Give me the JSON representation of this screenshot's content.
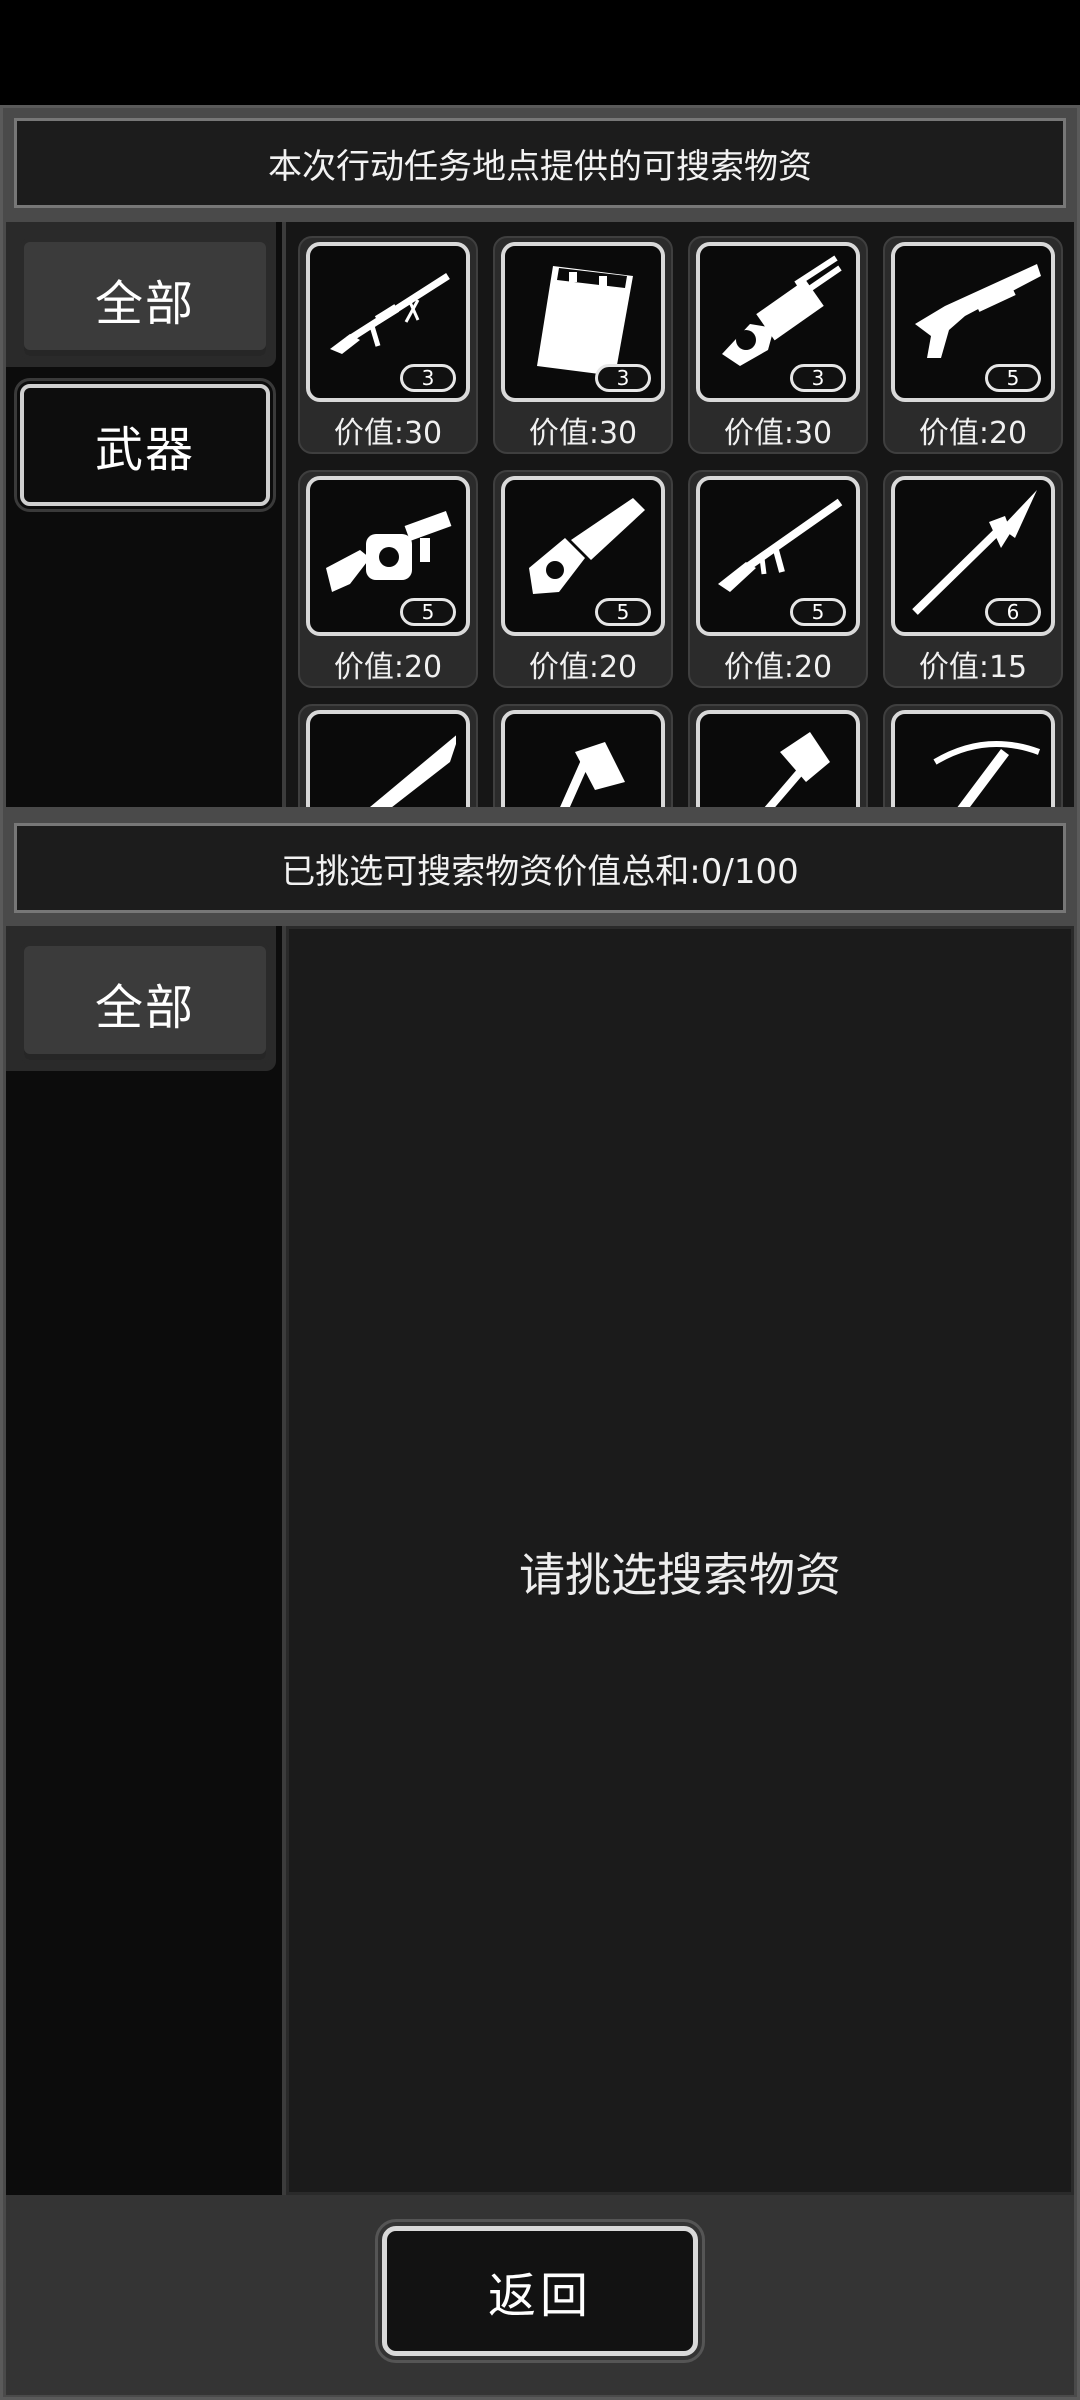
{
  "top_banner": {
    "text": "本次行动任务地点提供的可搜索物资"
  },
  "top_categories": [
    {
      "label": "全部",
      "selected": true
    },
    {
      "label": "武器",
      "selected": false
    }
  ],
  "items": [
    {
      "icon": "sniper-rifle-icon",
      "count": "3",
      "value": "价值:30"
    },
    {
      "icon": "riot-shield-icon",
      "count": "3",
      "value": "价值:30"
    },
    {
      "icon": "minigun-icon",
      "count": "3",
      "value": "价值:30"
    },
    {
      "icon": "shotgun-icon",
      "count": "5",
      "value": "价值:20"
    },
    {
      "icon": "grenade-launcher-icon",
      "count": "5",
      "value": "价值:20"
    },
    {
      "icon": "chainsaw-icon",
      "count": "5",
      "value": "价值:20"
    },
    {
      "icon": "assault-rifle-icon",
      "count": "5",
      "value": "价值:20"
    },
    {
      "icon": "spear-icon",
      "count": "6",
      "value": "价值:15"
    },
    {
      "icon": "sword-icon",
      "count": "",
      "value": ""
    },
    {
      "icon": "axe-icon",
      "count": "",
      "value": ""
    },
    {
      "icon": "war-hammer-icon",
      "count": "",
      "value": ""
    },
    {
      "icon": "crossbow-icon",
      "count": "",
      "value": ""
    }
  ],
  "selection_banner": {
    "text": "已挑选可搜索物资价值总和:0/100"
  },
  "bottom_categories": [
    {
      "label": "全部",
      "selected": true
    }
  ],
  "empty_message": "请挑选搜索物资",
  "back_button": {
    "label": "返回"
  }
}
